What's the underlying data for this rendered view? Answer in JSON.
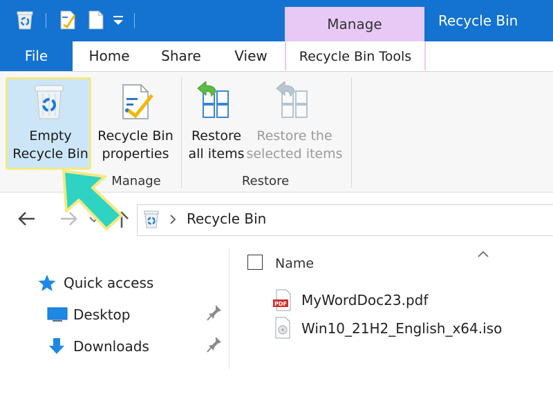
{
  "window": {
    "title": "Recycle Bin",
    "context_tab_group": "Manage"
  },
  "tabs": {
    "file": "File",
    "home": "Home",
    "share": "Share",
    "view": "View",
    "recycle_bin_tools": "Recycle Bin Tools"
  },
  "ribbon": {
    "manage_group": {
      "label": "Manage",
      "empty_recycle_bin": [
        "Empty",
        "Recycle Bin"
      ],
      "recycle_bin_properties": [
        "Recycle Bin",
        "properties"
      ]
    },
    "restore_group": {
      "label": "Restore",
      "restore_all": [
        "Restore",
        "all items"
      ],
      "restore_selected": [
        "Restore the",
        "selected items"
      ]
    }
  },
  "address_bar": {
    "location": "Recycle Bin"
  },
  "nav_pane": {
    "quick_access": "Quick access",
    "items": [
      {
        "label": "Desktop",
        "pinned": true
      },
      {
        "label": "Downloads",
        "pinned": true
      }
    ]
  },
  "file_list": {
    "column_name": "Name",
    "files": [
      {
        "name": "MyWordDoc23.pdf",
        "icon": "pdf-file-icon"
      },
      {
        "name": "Win10_21H2_English_x64.iso",
        "icon": "disc-image-file-icon"
      }
    ]
  },
  "colors": {
    "titlebar": "#1472d0",
    "context_tab": "#e8c9f6",
    "highlight": "#f3e982",
    "callout_arrow": "#2ed3c4"
  }
}
